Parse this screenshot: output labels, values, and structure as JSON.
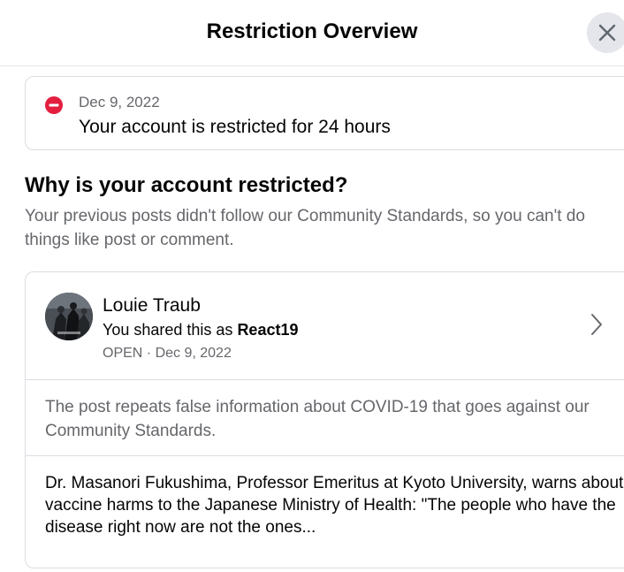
{
  "header": {
    "title": "Restriction Overview",
    "close_icon": "close-icon"
  },
  "status": {
    "icon": "stop-icon",
    "icon_color": "#e41e3f",
    "date": "Dec 9, 2022",
    "message": "Your account is restricted for 24 hours"
  },
  "why": {
    "title": "Why is your account restricted?",
    "description": "Your previous posts didn't follow our Community Standards, so you can't do things like post or comment."
  },
  "post": {
    "author": "Louie Traub",
    "shared_prefix": "You shared this as ",
    "shared_page": "React19",
    "meta": "OPEN · Dec 9, 2022",
    "violation": "The post repeats false information about COVID-19 that goes against our Community Standards.",
    "text": "Dr. Masanori Fukushima, Professor Emeritus at Kyoto University, warns about vaccine harms to the Japanese Ministry of Health: \"The people who have the disease right now are not the ones..."
  },
  "colors": {
    "secondary_text": "#65676b",
    "border": "#dadde1",
    "close_bg": "#e4e6eb"
  }
}
